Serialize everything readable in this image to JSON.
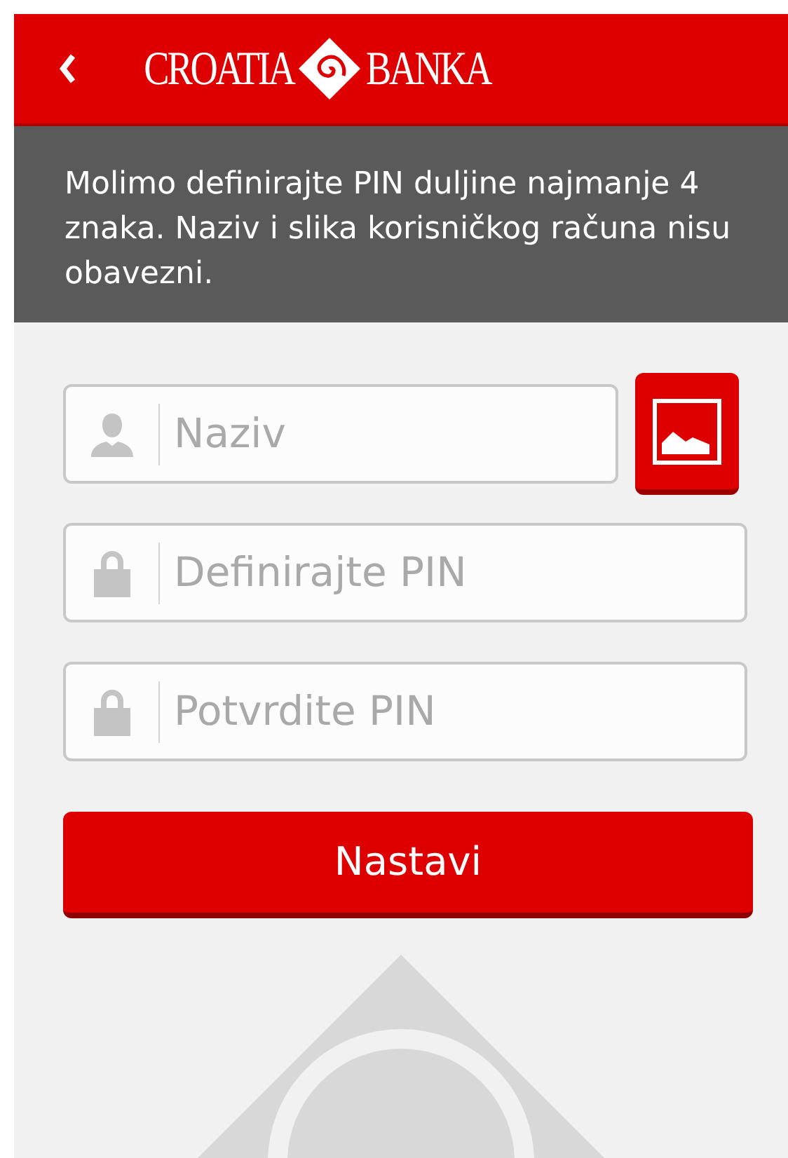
{
  "header": {
    "logo_left": "CROATIA",
    "logo_right": "BANKA"
  },
  "info": "Molimo definirajte PIN duljine najmanje 4 znaka. Naziv i slika korisničkog računa nisu obavezni.",
  "fields": [
    {
      "kind": "user",
      "placeholder": "Naziv"
    },
    {
      "kind": "lock",
      "placeholder": "Definirajte PIN"
    },
    {
      "kind": "lock",
      "placeholder": "Potvrdite PIN"
    }
  ],
  "button": "Nastavi"
}
